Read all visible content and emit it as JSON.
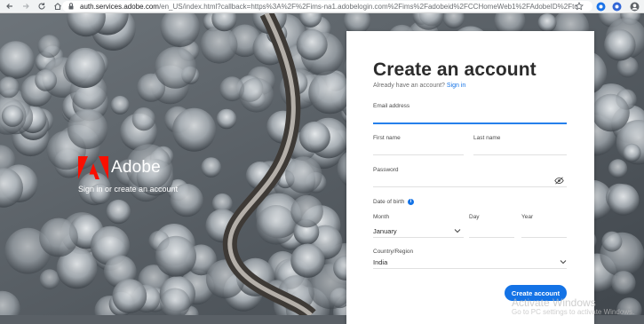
{
  "browser": {
    "url_host": "auth.services.adobe.com",
    "url_rest": "/en_US/index.html?callback=https%3A%2F%2Fims-na1.adobelogin.com%2Fims%2Fadobeid%2FCCHomeWeb1%2FAdobeID%2Ftoken%...",
    "icons": [
      "back-icon",
      "forward-icon",
      "reload-icon",
      "home-icon",
      "lock-icon",
      "star-icon",
      "extension-icon",
      "profile-icon"
    ]
  },
  "branding": {
    "name": "Adobe",
    "tagline": "Sign in or create an account",
    "brand_color": "#fa0f00"
  },
  "form": {
    "title": "Create an account",
    "have_account": "Already have an account?",
    "sign_in_link": "Sign in",
    "email_label": "Email address",
    "first_name_label": "First name",
    "last_name_label": "Last name",
    "password_label": "Password",
    "dob_label": "Date of birth",
    "month_label": "Month",
    "month_value": "January",
    "day_label": "Day",
    "year_label": "Year",
    "country_label": "Country/Region",
    "country_value": "India",
    "submit_label": "Create account",
    "accent_color": "#1473e6"
  },
  "os_watermark": {
    "line1": "Activate Windows",
    "line2": "Go to PC settings to activate Windows."
  }
}
